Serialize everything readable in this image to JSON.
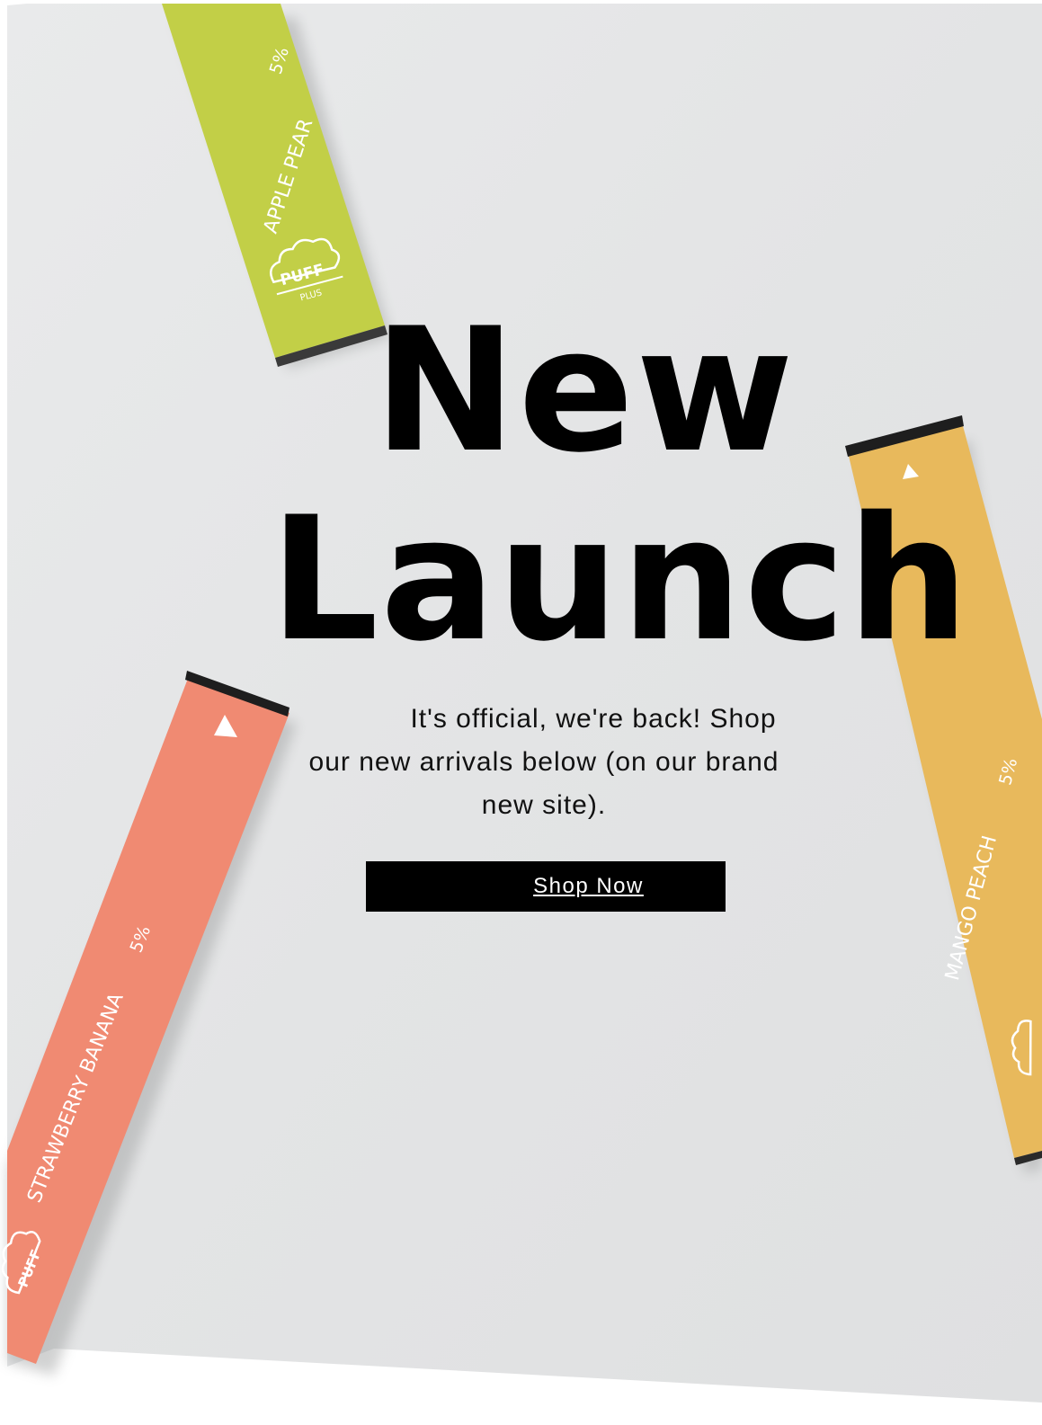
{
  "hero": {
    "headline_line1": "New",
    "headline_line2": "Launch",
    "subtext": "It's official, we're back! Shop our new arrivals below (on our brand new site).",
    "cta_label": "Shop Now"
  },
  "products": [
    {
      "flavor": "APPLE PEAR",
      "strength": "5%",
      "brand": "PUFF",
      "sub_brand": "PLUS",
      "color": "#c2cf47"
    },
    {
      "flavor": "MANGO PEACH",
      "strength": "5%",
      "brand": "PUFF",
      "color": "#e8b95c"
    },
    {
      "flavor": "STRAWBERRY BANANA",
      "strength": "5%",
      "brand": "PUFF",
      "color": "#f08a72"
    }
  ],
  "colors": {
    "background": "#e4e5e6",
    "headline": "#000000",
    "button_bg": "#000000",
    "button_text": "#ffffff"
  }
}
